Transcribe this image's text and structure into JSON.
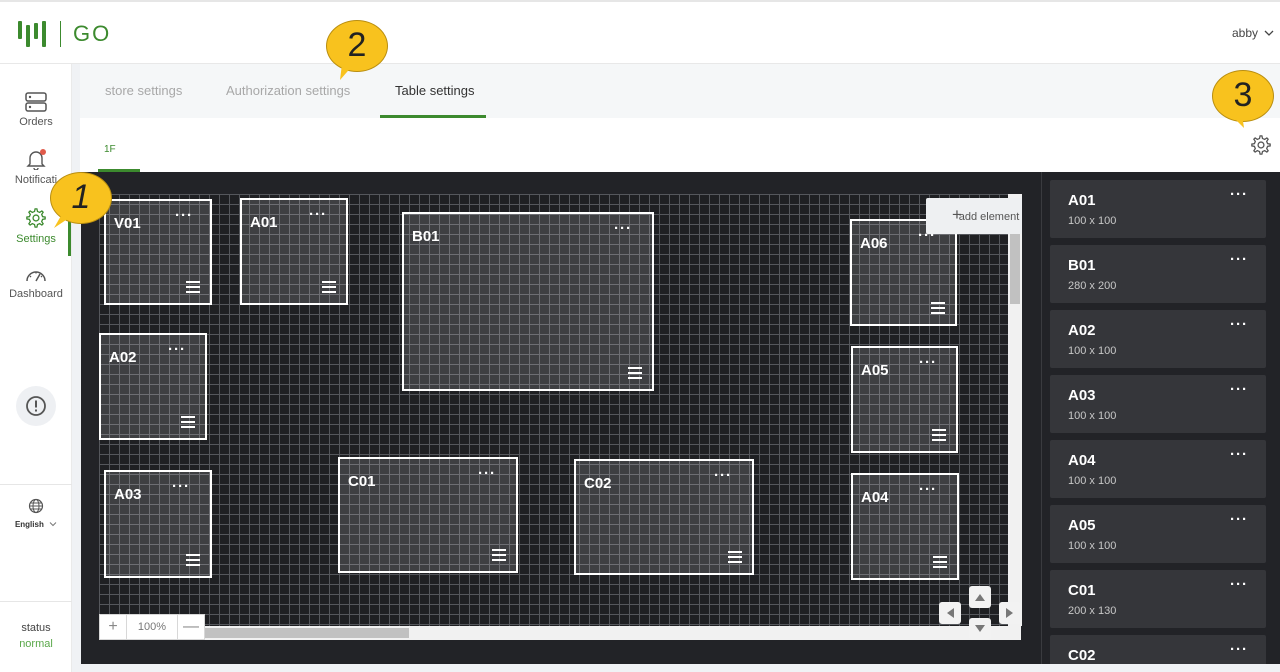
{
  "header": {
    "logo_text": "GO",
    "user_name": "abby"
  },
  "sidebar": {
    "items": [
      {
        "label": "Orders",
        "icon": "server-icon"
      },
      {
        "label": "Notificati",
        "icon": "bell-icon"
      },
      {
        "label": "Settings",
        "icon": "gear-icon"
      },
      {
        "label": "Dashboard",
        "icon": "gauge-icon"
      }
    ],
    "active": "Settings",
    "language": "English",
    "status_label": "status",
    "status_value": "normal"
  },
  "tabs": {
    "items": [
      "store settings",
      "Authorization settings",
      "Table settings"
    ],
    "active": "Table settings"
  },
  "floor_tab": "1F",
  "canvas": {
    "add_element_label": "add element",
    "zoom_value": "100%",
    "zoom_in": "+",
    "zoom_out": "—",
    "tables": [
      {
        "name": "V01"
      },
      {
        "name": "A01"
      },
      {
        "name": "B01"
      },
      {
        "name": "A06"
      },
      {
        "name": "A02"
      },
      {
        "name": "A05"
      },
      {
        "name": "A03"
      },
      {
        "name": "C01"
      },
      {
        "name": "C02"
      },
      {
        "name": "A04"
      }
    ]
  },
  "table_list": [
    {
      "name": "A01",
      "size": "100 x 100"
    },
    {
      "name": "B01",
      "size": "280 x 200"
    },
    {
      "name": "A02",
      "size": "100 x 100"
    },
    {
      "name": "A03",
      "size": "100 x 100"
    },
    {
      "name": "A04",
      "size": "100 x 100"
    },
    {
      "name": "A05",
      "size": "100 x 100"
    },
    {
      "name": "C01",
      "size": "200 x 130"
    },
    {
      "name": "C02",
      "size": ""
    }
  ],
  "callouts": [
    "1",
    "2",
    "3"
  ],
  "colors": {
    "brand_green": "#3c8a2e",
    "callout_yellow": "#f8c21e",
    "canvas_bg": "#222327",
    "notification_dot": "#e05a4a"
  },
  "more_glyph": "···"
}
